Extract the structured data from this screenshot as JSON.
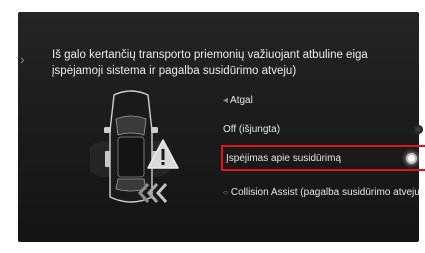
{
  "header": {
    "title_line1": "Iš galo kertančių transporto priemonių važiuojant atbuline eiga",
    "title_line2": "įspėjamoji sistema ir pagalba susidūrimo atveju)"
  },
  "menu": {
    "back_label": "Atgal",
    "items": [
      {
        "label": "Off (išjungta)",
        "selected": false
      },
      {
        "label": "Įspėjimas apie susidūrimą",
        "selected": true
      },
      {
        "label": "Collision Assist (pagalba susidūrimo atveju)",
        "selected": false
      }
    ]
  },
  "colors": {
    "highlight_border": "#e2141e",
    "text": "#e6e6e6",
    "background": "#1e1e1e"
  },
  "icons": {
    "car": "car-top-view-icon",
    "warning": "warning-triangle-icon",
    "direction": "reverse-arrows-icon",
    "back": "chevron-left-icon"
  }
}
